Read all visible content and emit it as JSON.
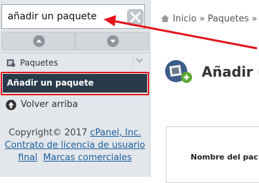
{
  "search": {
    "value": "añadir un paquete"
  },
  "sidebar": {
    "section_label": "Paquetes",
    "selected_item": "Añadir un paquete",
    "back_to_top": "Volver arriba"
  },
  "footer": {
    "copyright": "Copyright© 2017",
    "company": "cPanel, Inc.",
    "license_link": "Contrato de licencia de usuario final",
    "trademarks_link": "Marcas comerciales"
  },
  "breadcrumb": {
    "home": "Inicio",
    "sep": "»",
    "packages": "Paquetes",
    "sep2": "»"
  },
  "main": {
    "title": "Añadir u",
    "field_label": "Nombre del pac"
  },
  "colors": {
    "highlight": "#e4141b",
    "selected_bg": "#293a4a"
  }
}
